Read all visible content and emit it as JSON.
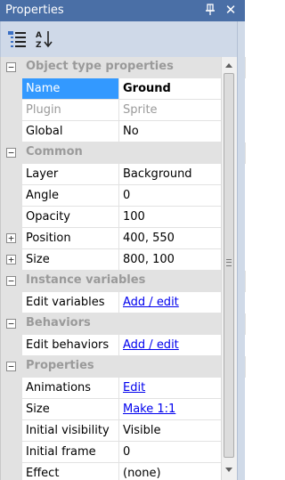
{
  "window": {
    "title": "Properties",
    "pin_icon": "pin-icon",
    "close_icon": "close-icon",
    "close_glyph": "✕",
    "accent": "#4a6fa6"
  },
  "toolbar": {
    "buttons": [
      {
        "icon": "categorized-view-icon"
      },
      {
        "icon": "alphabetical-sort-icon"
      }
    ]
  },
  "grid": {
    "rows": [
      {
        "type": "category",
        "label": "Object type properties",
        "toggle": "−"
      },
      {
        "type": "property",
        "name": "Name",
        "value": "Ground",
        "selected": true,
        "bold": true
      },
      {
        "type": "property",
        "name": "Plugin",
        "value": "Sprite",
        "disabled": true
      },
      {
        "type": "property",
        "name": "Global",
        "value": "No"
      },
      {
        "type": "category",
        "label": "Common",
        "toggle": "−"
      },
      {
        "type": "property",
        "name": "Layer",
        "value": "Background"
      },
      {
        "type": "property",
        "name": "Angle",
        "value": "0"
      },
      {
        "type": "property",
        "name": "Opacity",
        "value": "100"
      },
      {
        "type": "property",
        "name": "Position",
        "value": "400, 550",
        "expandable": true,
        "toggle": "+"
      },
      {
        "type": "property",
        "name": "Size",
        "value": "800, 100",
        "expandable": true,
        "toggle": "+"
      },
      {
        "type": "category",
        "label": "Instance variables",
        "toggle": "−"
      },
      {
        "type": "property",
        "name": "Edit variables",
        "value": "Add / edit",
        "link": true
      },
      {
        "type": "category",
        "label": "Behaviors",
        "toggle": "−"
      },
      {
        "type": "property",
        "name": "Edit behaviors",
        "value": "Add / edit",
        "link": true
      },
      {
        "type": "category",
        "label": "Properties",
        "toggle": "−"
      },
      {
        "type": "property",
        "name": "Animations",
        "value": "Edit",
        "link": true
      },
      {
        "type": "property",
        "name": "Size",
        "value": "Make 1:1",
        "link": true
      },
      {
        "type": "property",
        "name": "Initial visibility",
        "value": "Visible"
      },
      {
        "type": "property",
        "name": "Initial frame",
        "value": "0"
      },
      {
        "type": "property",
        "name": "Effect",
        "value": "(none)"
      }
    ]
  }
}
